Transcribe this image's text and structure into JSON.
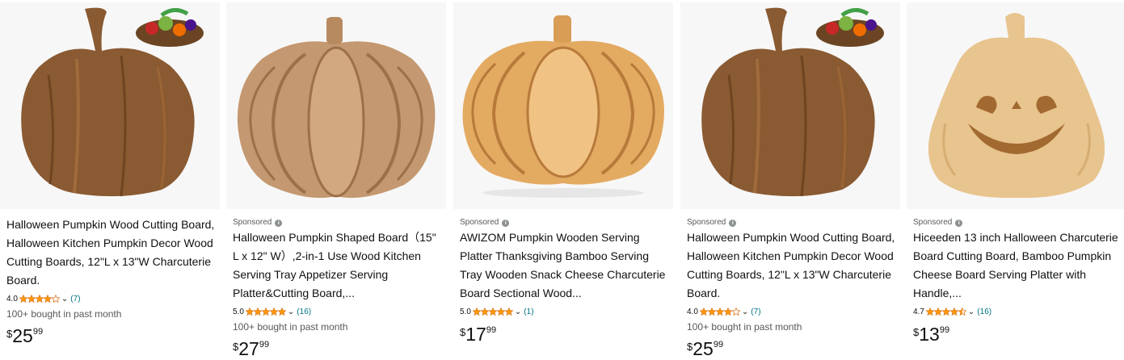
{
  "colors": {
    "star": "#ff9900",
    "link": "#007185",
    "muted": "#565959",
    "wood_dark": "#7a4e2b",
    "wood_light": "#e2b67a"
  },
  "products": [
    {
      "image_icon": "pumpkin-cutting-board-dark",
      "sponsored": "",
      "title": "Halloween Pumpkin Wood Cutting Board, Halloween Kitchen Pumpkin Decor Wood Cutting Boards, 12\"L x 13\"W Charcuterie Board.",
      "rating": "4.0",
      "stars": 4.0,
      "review_count": "(7)",
      "bought": "100+ bought in past month",
      "price_symbol": "$",
      "price_whole": "25",
      "price_fraction": "99"
    },
    {
      "image_icon": "pumpkin-shaped-board-oak",
      "sponsored": "Sponsored",
      "title": "Halloween Pumpkin Shaped Board（15\" L x 12\" W）,2-in-1 Use Wood Kitchen Serving Tray Appetizer Serving Platter&Cutting Board,...",
      "rating": "5.0",
      "stars": 5.0,
      "review_count": "(16)",
      "bought": "100+ bought in past month",
      "price_symbol": "$",
      "price_whole": "27",
      "price_fraction": "99"
    },
    {
      "image_icon": "pumpkin-bamboo-platter",
      "sponsored": "Sponsored",
      "title": "AWIZOM Pumpkin Wooden Serving Platter Thanksgiving Bamboo Serving Tray Wooden Snack Cheese Charcuterie Board Sectional Wood...",
      "rating": "5.0",
      "stars": 5.0,
      "review_count": "(1)",
      "bought": "",
      "price_symbol": "$",
      "price_whole": "17",
      "price_fraction": "99"
    },
    {
      "image_icon": "pumpkin-cutting-board-dark",
      "sponsored": "Sponsored",
      "title": "Halloween Pumpkin Wood Cutting Board, Halloween Kitchen Pumpkin Decor Wood Cutting Boards, 12\"L x 13\"W Charcuterie Board.",
      "rating": "4.0",
      "stars": 4.0,
      "review_count": "(7)",
      "bought": "100+ bought in past month",
      "price_symbol": "$",
      "price_whole": "25",
      "price_fraction": "99"
    },
    {
      "image_icon": "jack-o-lantern-bamboo-board",
      "sponsored": "Sponsored",
      "title": "Hiceeden 13 inch Halloween Charcuterie Board Cutting Board, Bamboo Pumpkin Cheese Board Serving Platter with Handle,...",
      "rating": "4.7",
      "stars": 4.5,
      "review_count": "(16)",
      "bought": "",
      "price_symbol": "$",
      "price_whole": "13",
      "price_fraction": "99"
    }
  ]
}
